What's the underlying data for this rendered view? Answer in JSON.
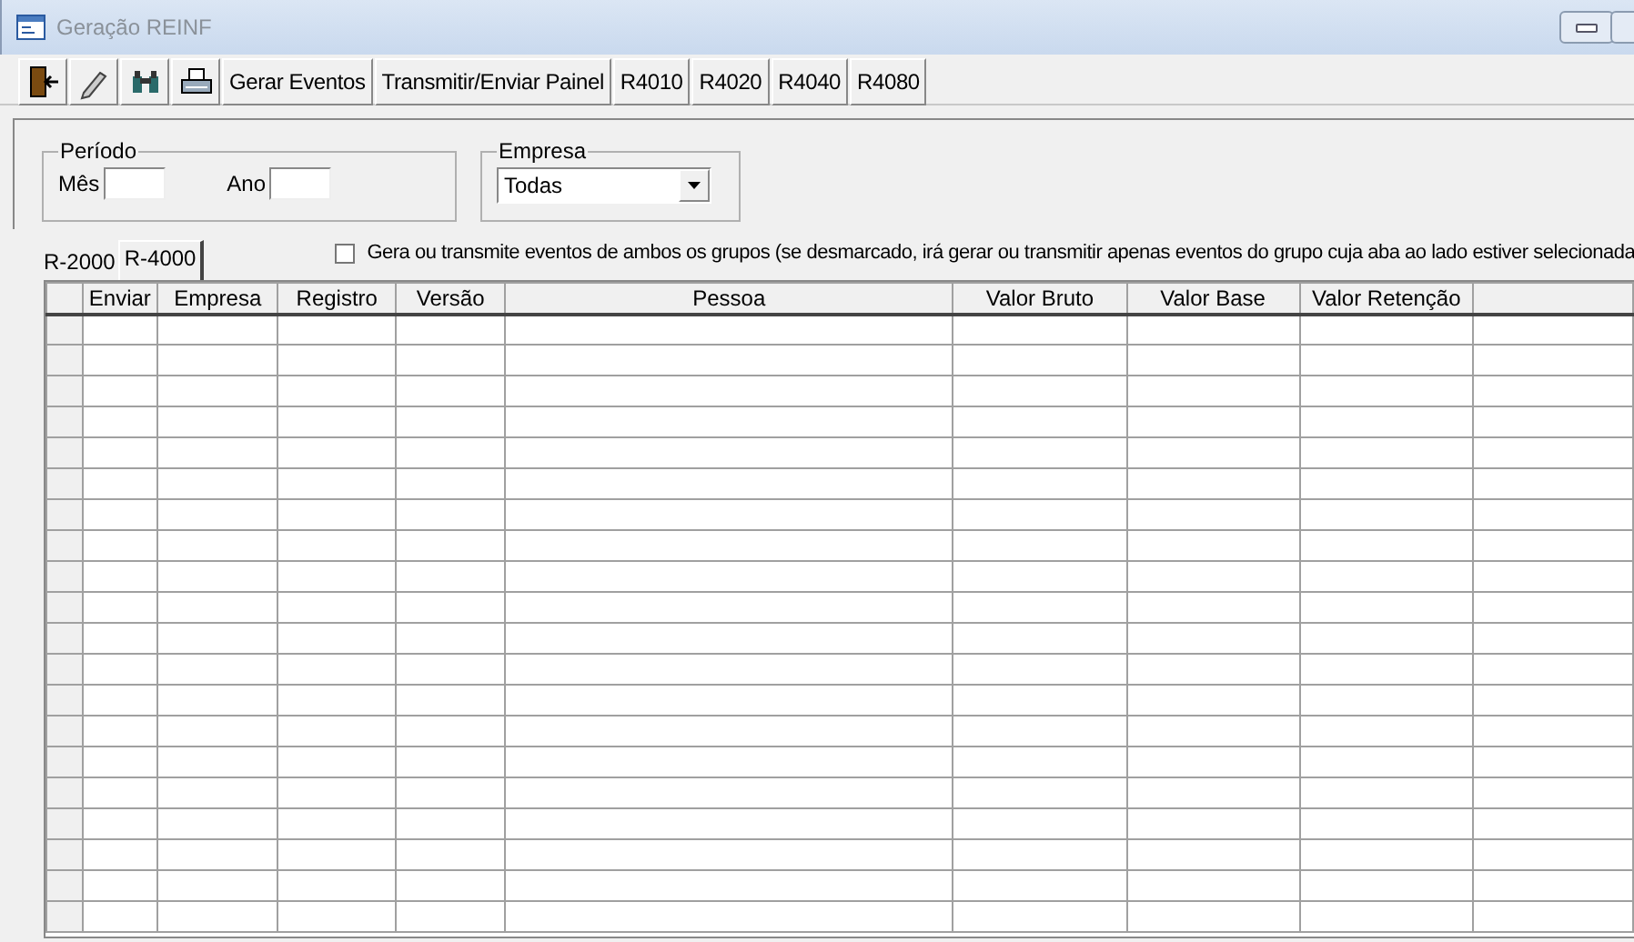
{
  "window": {
    "title": "Geração REINF"
  },
  "toolbar": [
    {
      "kind": "icon"
    },
    {
      "kind": "icon"
    },
    {
      "kind": "icon"
    },
    {
      "kind": "icon"
    },
    {
      "kind": "text",
      "label": "Gerar Eventos"
    },
    {
      "kind": "text",
      "label": "Transmitir/Enviar Painel"
    },
    {
      "kind": "text",
      "label": "R4010"
    },
    {
      "kind": "text",
      "label": "R4020"
    },
    {
      "kind": "text",
      "label": "R4040"
    },
    {
      "kind": "text",
      "label": "R4080"
    }
  ],
  "periodo": {
    "legend": "Período",
    "mes_label": "Mês",
    "ano_label": "Ano"
  },
  "empresa": {
    "legend": "Empresa",
    "value": "Todas"
  },
  "tabs": [
    {
      "label": "R-2000",
      "selected": false
    },
    {
      "label": "R-4000",
      "selected": true
    }
  ],
  "both_groups": {
    "label": "Gera ou transmite eventos de ambos os grupos (se desmarcado, irá gerar ou transmitir apenas eventos do grupo cuja aba ao lado estiver selecionada",
    "checked": false
  },
  "table": {
    "columns": [
      "Enviar",
      "Empresa",
      "Registro",
      "Versão",
      "Pessoa",
      "Valor Bruto",
      "Valor Base",
      "Valor Retenção"
    ]
  }
}
